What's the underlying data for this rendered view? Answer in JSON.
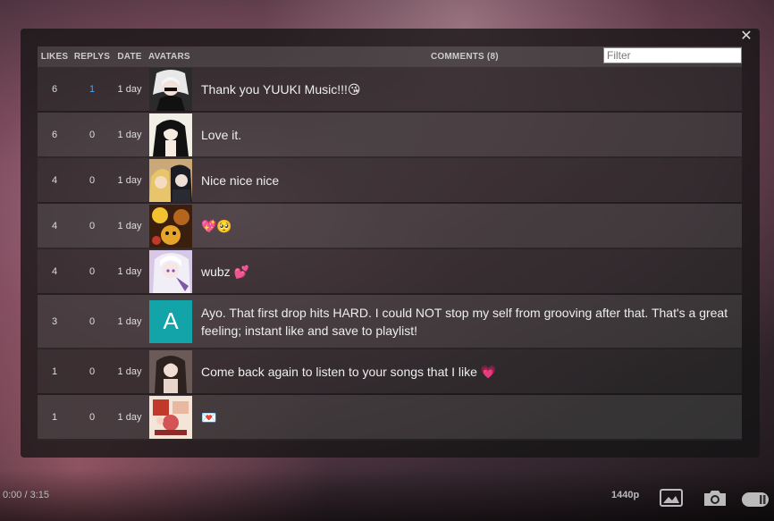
{
  "comments_panel": {
    "headers": {
      "likes": "LIKES",
      "replys": "REPLYS",
      "date": "DATE",
      "avatars": "AVATARS",
      "comments": "COMMENTS (8)"
    },
    "filter_placeholder": "Filter",
    "rows": [
      {
        "likes": "6",
        "replys": "1",
        "date": "1 day",
        "text": "Thank you YUUKI Music!!!",
        "emoji": "😘"
      },
      {
        "likes": "6",
        "replys": "0",
        "date": "1 day",
        "text": "Love it.",
        "emoji": ""
      },
      {
        "likes": "4",
        "replys": "0",
        "date": "1 day",
        "text": "Nice nice nice",
        "emoji": ""
      },
      {
        "likes": "4",
        "replys": "0",
        "date": "1 day",
        "text": "",
        "emoji": "💖🥺"
      },
      {
        "likes": "4",
        "replys": "0",
        "date": "1 day",
        "text": "wubz ",
        "emoji": "💕"
      },
      {
        "likes": "3",
        "replys": "0",
        "date": "1 day",
        "text": "Ayo. That first drop hits HARD. I could NOT stop my self from grooving after that. That's a great feeling; instant like and save to playlist!",
        "emoji": "",
        "avatar_letter": "A"
      },
      {
        "likes": "1",
        "replys": "0",
        "date": "1 day",
        "text": "Come back again to listen to your songs that I like ",
        "emoji": "💗"
      },
      {
        "likes": "1",
        "replys": "0",
        "date": "1 day",
        "text": "",
        "emoji": "💌"
      }
    ]
  },
  "player": {
    "time": "0:00 / 3:15",
    "quality": "1440p"
  },
  "icons": [
    "close-icon",
    "image-icon",
    "camera-icon",
    "pause-icon"
  ],
  "colors": {
    "reply_highlight": "#3ea6ff",
    "letter_avatar_bg": "#12a4a8"
  }
}
